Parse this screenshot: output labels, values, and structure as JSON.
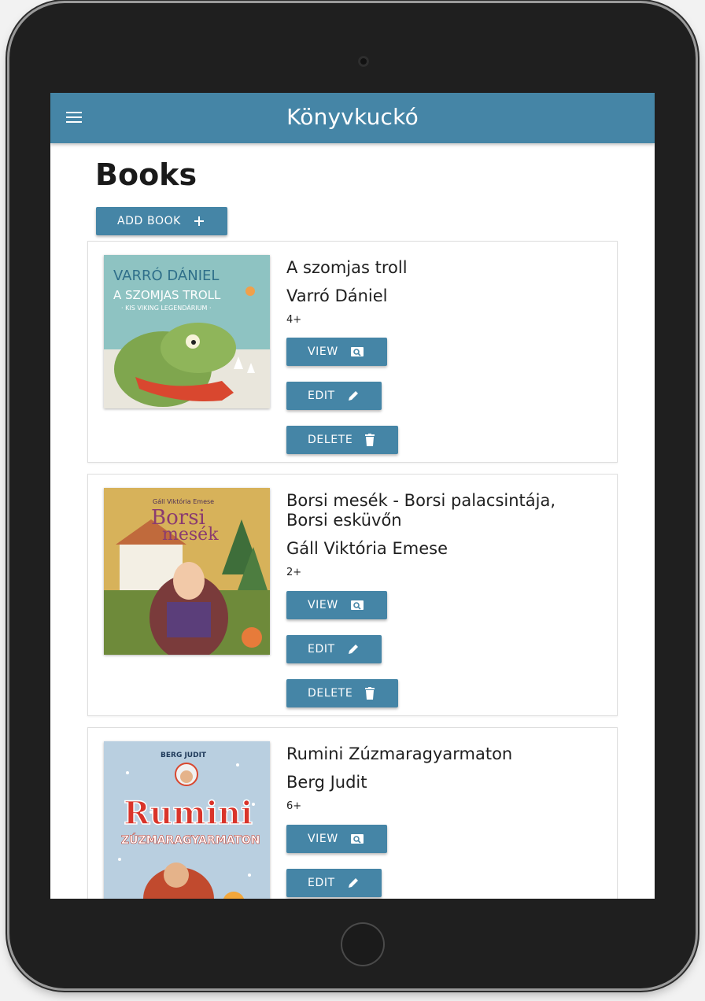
{
  "app": {
    "title": "Könyvkuckó"
  },
  "page": {
    "title": "Books",
    "add_label": "ADD BOOK"
  },
  "icons": {
    "menu": "menu-icon",
    "add": "plus-icon",
    "view": "search-icon",
    "edit": "pencil-icon",
    "delete": "trash-icon"
  },
  "colors": {
    "primary": "#4585a6",
    "surface": "#ffffff",
    "frame": "#1f1f1f"
  },
  "books": [
    {
      "title": "A szomjas troll",
      "author": "Varró Dániel",
      "age": "4+",
      "cover_lines": [
        "VARRÓ DÁNIEL",
        "A SZOMJAS TROLL",
        "· KIS VIKING LEGENDÁRIUM ·"
      ],
      "actions": {
        "view": "VIEW",
        "edit": "EDIT",
        "delete": "DELETE"
      }
    },
    {
      "title": "Borsi mesék - Borsi palacsintája, Borsi esküvőn",
      "author": "Gáll Viktória Emese",
      "age": "2+",
      "cover_lines": [
        "Gáll Viktória Emese",
        "Borsi",
        "mesék"
      ],
      "actions": {
        "view": "VIEW",
        "edit": "EDIT",
        "delete": "DELETE"
      }
    },
    {
      "title": "Rumini Zúzmaragyarmaton",
      "author": "Berg Judit",
      "age": "6+",
      "cover_lines": [
        "BERG JUDIT",
        "Rumini",
        "ZÚZMARAGYARMATON"
      ],
      "actions": {
        "view": "VIEW",
        "edit": "EDIT"
      }
    }
  ]
}
